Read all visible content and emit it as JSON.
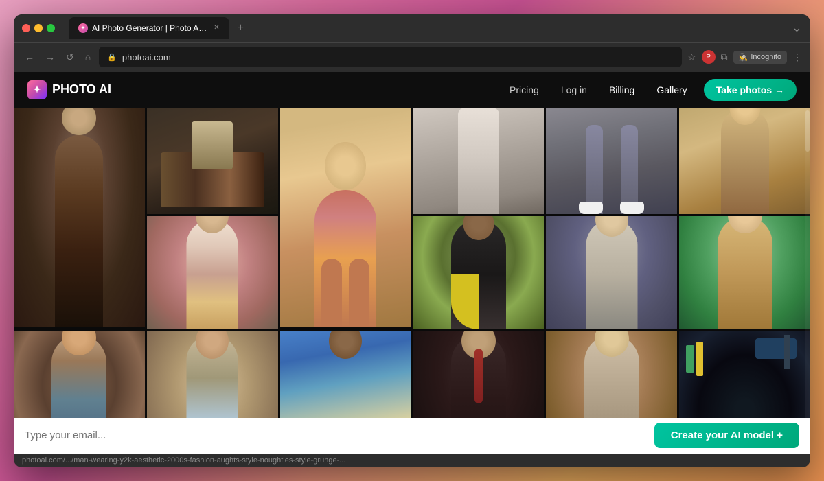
{
  "browser": {
    "title": "AI Photo Generator | Photo AI",
    "url": "photoai.com",
    "tab_label": "AI Photo Generator | Photo A…",
    "incognito_label": "Incognito",
    "status_url": "photoai.com/.../man-wearing-y2k-aesthetic-2000s-fashion-aughts-style-noughties-style-grunge-..."
  },
  "nav": {
    "logo_text": "PHOTO AI",
    "pricing_label": "Pricing",
    "login_label": "Log in",
    "billing_label": "Billing",
    "gallery_label": "Gallery",
    "take_photos_label": "Take photos →"
  },
  "gallery": {
    "photos": [
      {
        "id": 1,
        "alt": "Man in dark suit",
        "col": 1,
        "row": 1,
        "rowspan": 2
      },
      {
        "id": 2,
        "alt": "Books on table",
        "col": 2,
        "row": 1
      },
      {
        "id": 3,
        "alt": "Woman in fitness wear",
        "col": 3,
        "row": 1,
        "rowspan": 2
      },
      {
        "id": 4,
        "alt": "White wide pants",
        "col": 4,
        "row": 1
      },
      {
        "id": 5,
        "alt": "Woman legs with sneakers",
        "col": 5,
        "row": 1
      },
      {
        "id": 6,
        "alt": "Woman in golden light",
        "col": 6,
        "row": 1
      },
      {
        "id": 7,
        "alt": "Asian man in tank top",
        "col": 2,
        "row": 2
      },
      {
        "id": 8,
        "alt": "Woman in yellow jacket",
        "col": 4,
        "row": 2
      },
      {
        "id": 9,
        "alt": "Man in casual jacket",
        "col": 5,
        "row": 2
      },
      {
        "id": 10,
        "alt": "Woman in sweater outdoors",
        "col": 6,
        "row": 2
      },
      {
        "id": 11,
        "alt": "Man in Y2K style",
        "col": 1,
        "row": 3
      },
      {
        "id": 12,
        "alt": "Woman in crop top",
        "col": 2,
        "row": 3
      },
      {
        "id": 13,
        "alt": "Man on beach",
        "col": 3,
        "row": 3
      },
      {
        "id": 14,
        "alt": "Man in formal suit",
        "col": 4,
        "row": 3
      },
      {
        "id": 15,
        "alt": "Man in cafe",
        "col": 5,
        "row": 3
      },
      {
        "id": 16,
        "alt": "Crowd at night festival",
        "col": 6,
        "row": 3
      }
    ]
  },
  "footer": {
    "email_placeholder": "Type your email...",
    "cta_label": "Create your AI model +"
  }
}
